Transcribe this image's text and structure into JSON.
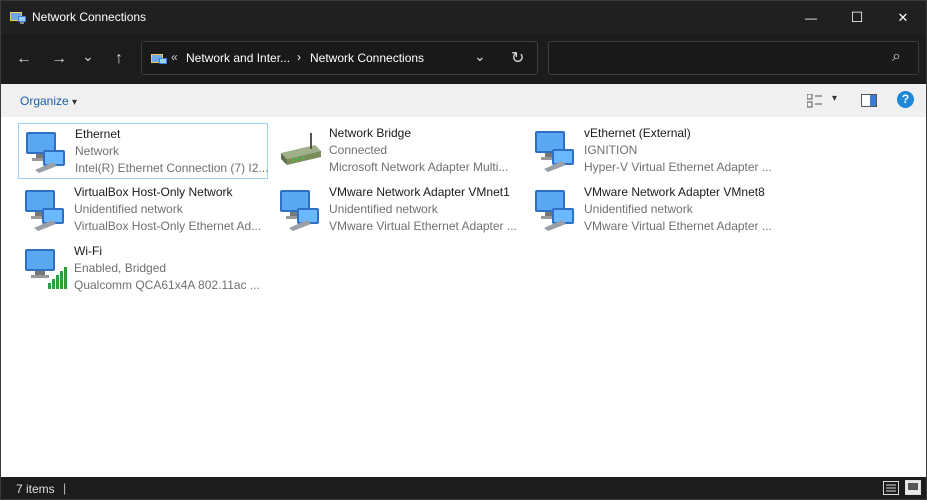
{
  "window": {
    "title": "Network Connections",
    "minimize_glyph": "—",
    "maximize_glyph": "☐",
    "close_glyph": "✕"
  },
  "nav": {
    "back_glyph": "←",
    "forward_glyph": "→",
    "recent_glyph": "⌄",
    "up_glyph": "↑"
  },
  "address": {
    "overflow": "«",
    "crumbs": [
      "Network and Inter...",
      "Network Connections"
    ],
    "separator": "›",
    "dropdown_glyph": "⌄",
    "refresh_glyph": "↻"
  },
  "search": {
    "value": "",
    "icon_glyph": "⌕"
  },
  "command_bar": {
    "organize_label": "Organize",
    "organize_arrow": "▾",
    "view_arrow": "▾",
    "help_glyph": "?"
  },
  "items": [
    {
      "name": "Ethernet",
      "status": "Network",
      "device": "Intel(R) Ethernet Connection (7) I2...",
      "icon": "network-adapter-icon",
      "selected": true
    },
    {
      "name": "Network Bridge",
      "status": "Connected",
      "device": "Microsoft Network Adapter Multi...",
      "icon": "network-bridge-icon",
      "selected": false
    },
    {
      "name": "vEthernet (External)",
      "status": "IGNITION",
      "device": "Hyper-V Virtual Ethernet Adapter ...",
      "icon": "network-adapter-icon",
      "selected": false
    },
    {
      "name": "VirtualBox Host-Only Network",
      "status": "Unidentified network",
      "device": "VirtualBox Host-Only Ethernet Ad...",
      "icon": "network-adapter-icon",
      "selected": false
    },
    {
      "name": "VMware Network Adapter VMnet1",
      "status": "Unidentified network",
      "device": "VMware Virtual Ethernet Adapter ...",
      "icon": "network-adapter-icon",
      "selected": false
    },
    {
      "name": "VMware Network Adapter VMnet8",
      "status": "Unidentified network",
      "device": "VMware Virtual Ethernet Adapter ...",
      "icon": "network-adapter-icon",
      "selected": false
    },
    {
      "name": "Wi-Fi",
      "status": "Enabled, Bridged",
      "device": "Qualcomm QCA61x4A 802.11ac ...",
      "icon": "wifi-adapter-icon",
      "selected": false
    }
  ],
  "status_bar": {
    "item_count": "7 items",
    "divider": "|"
  },
  "colors": {
    "titlebar": "#202020",
    "accent_link": "#1a5ea8",
    "selection_border": "#99d1ff",
    "help": "#1e88d8"
  }
}
